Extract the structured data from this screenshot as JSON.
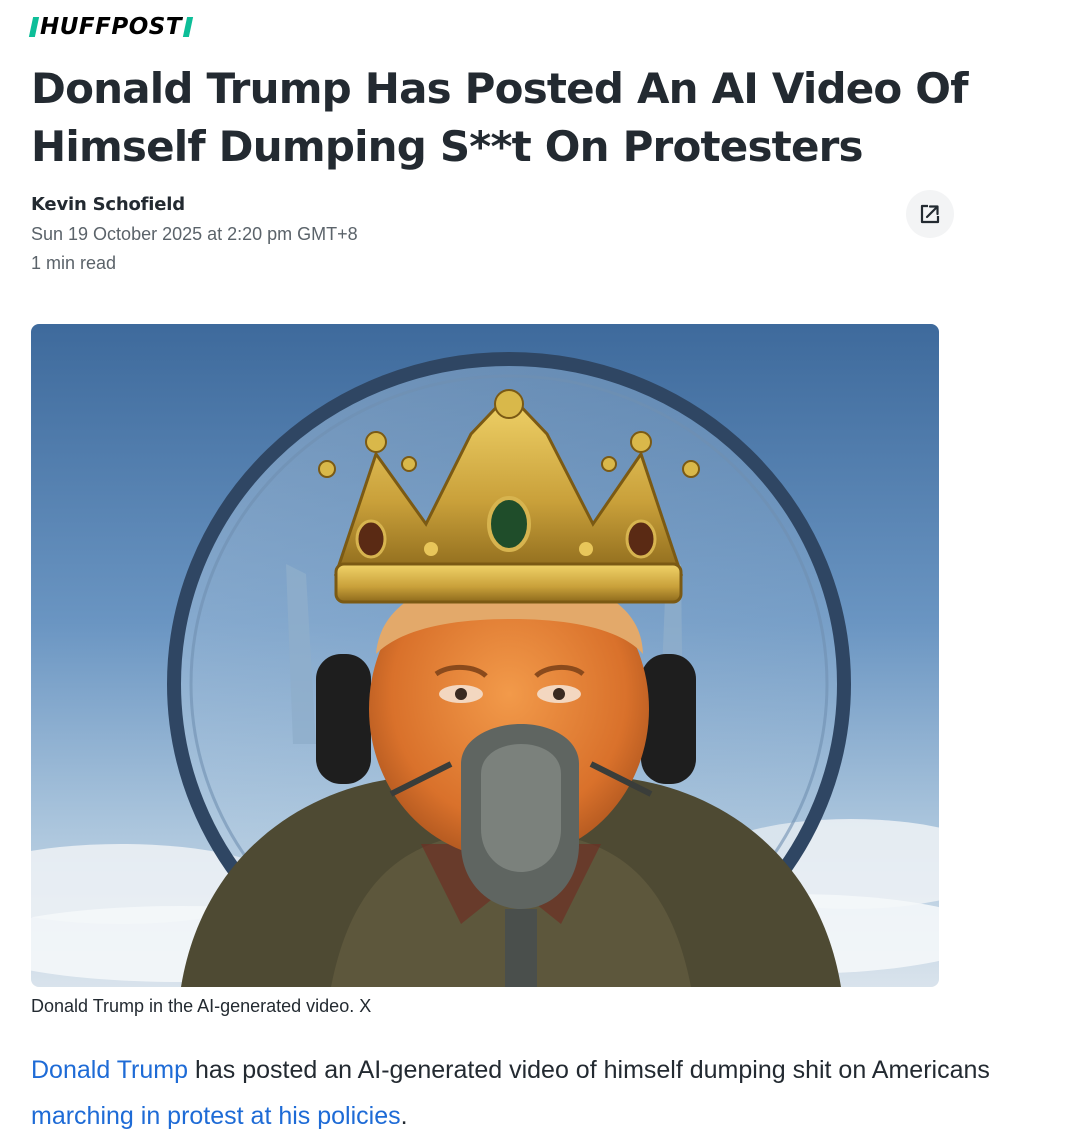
{
  "publication": {
    "logo_text": "HUFFPOST",
    "brand_color": "#0dbe98"
  },
  "article": {
    "headline": "Donald Trump Has Posted An AI Video Of Himself Dumping S**t On Protesters",
    "author": "Kevin Schofield",
    "date": "Sun 19 October 2025 at 2:20 pm GMT+8",
    "read_time": "1 min read",
    "share_icon": "external-share-icon",
    "image_caption": "Donald Trump in the AI-generated video. X",
    "body": {
      "link_1": "Donald Trump",
      "text_1": " has posted an AI-generated video of himself dumping shit on Americans ",
      "link_2": "marching in protest at his policies",
      "text_2": "."
    }
  },
  "colors": {
    "link": "#1e6bd6",
    "headline": "#232a31",
    "meta": "#5b636a"
  }
}
